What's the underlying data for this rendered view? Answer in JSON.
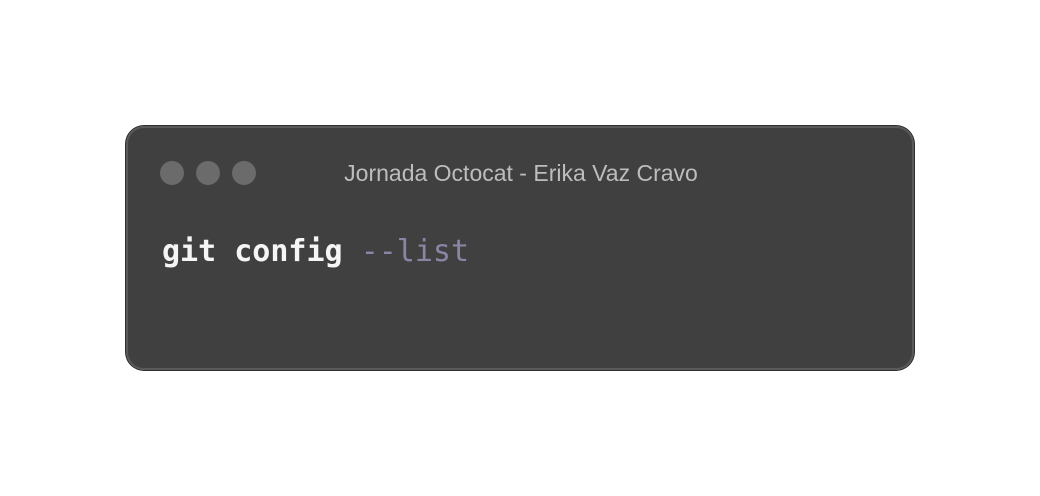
{
  "window": {
    "title": "Jornada Octocat - Erika Vaz Cravo",
    "controls": [
      "close",
      "minimize",
      "maximize"
    ]
  },
  "code": {
    "command": "git config",
    "flag": "--list"
  },
  "colors": {
    "window_bg": "#404040",
    "title_text": "#bdbdbd",
    "command_text": "#f5f5f5",
    "flag_text": "#8c84a4",
    "control_dot": "#6b6b6b"
  }
}
